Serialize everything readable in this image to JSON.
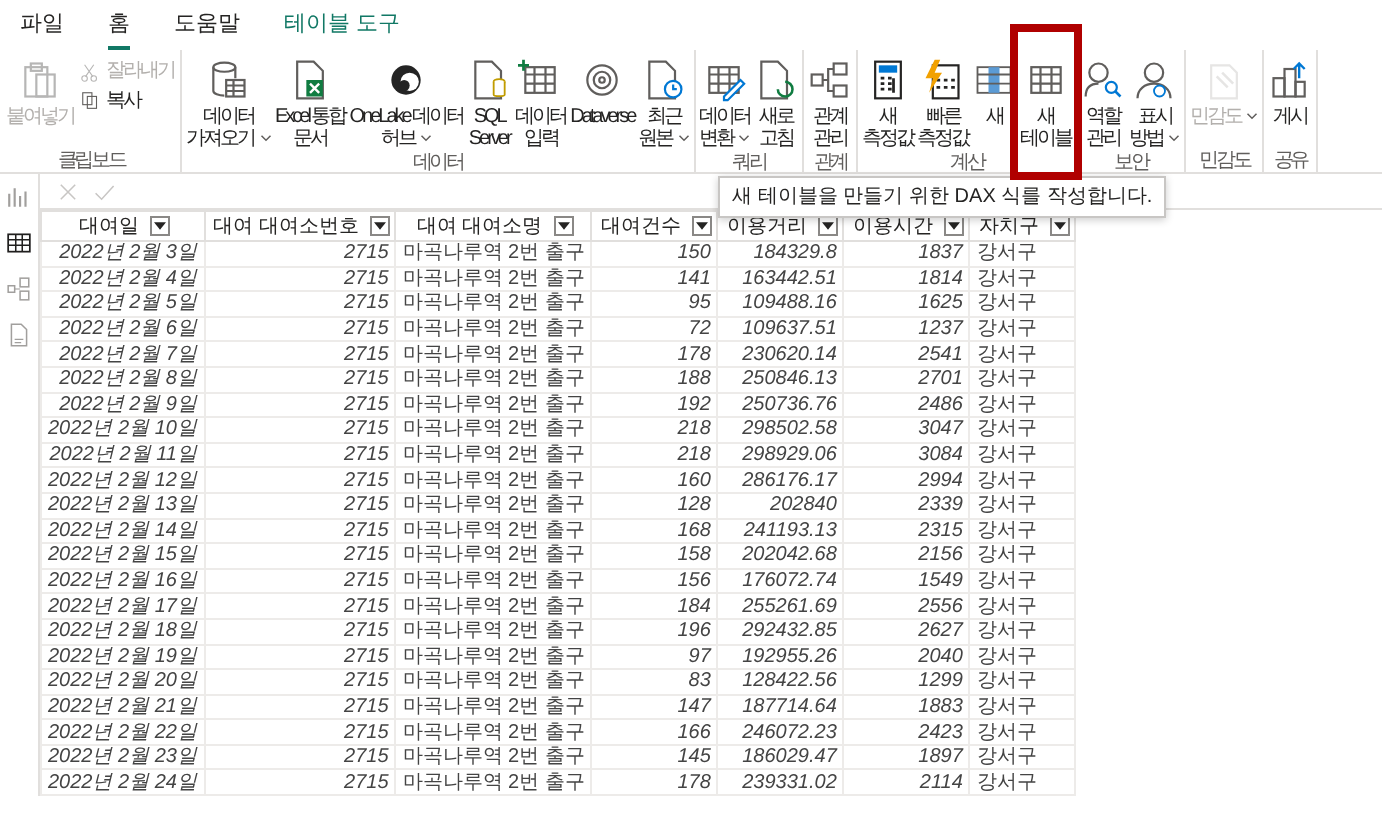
{
  "tabs": [
    {
      "label": "파일",
      "selected": false,
      "kind": "normal"
    },
    {
      "label": "홈",
      "selected": true,
      "kind": "normal"
    },
    {
      "label": "도움말",
      "selected": false,
      "kind": "normal"
    },
    {
      "label": "테이블 도구",
      "selected": false,
      "kind": "contextual"
    }
  ],
  "ribbon": {
    "groups": [
      {
        "label": "클립보드",
        "buttons": [
          {
            "kind": "large",
            "lines": [
              "붙여넣기"
            ],
            "disabled": true,
            "dropdown": false
          },
          {
            "kind": "small",
            "lines": [
              "잘라내기"
            ],
            "disabled": true,
            "dropdown": false
          },
          {
            "kind": "small",
            "lines": [
              "복사"
            ],
            "disabled": false,
            "dropdown": false
          }
        ]
      },
      {
        "label": "데이터",
        "buttons": [
          {
            "kind": "large",
            "lines": [
              "데이터",
              "가져오기"
            ],
            "disabled": false,
            "dropdown": true
          },
          {
            "kind": "large",
            "lines": [
              "Excel 통합",
              "문서"
            ],
            "disabled": false,
            "dropdown": false
          },
          {
            "kind": "large",
            "lines": [
              "OneLake 데이터",
              "허브"
            ],
            "disabled": false,
            "dropdown": true
          },
          {
            "kind": "large",
            "lines": [
              "SQL",
              "Server"
            ],
            "disabled": false,
            "dropdown": false
          },
          {
            "kind": "large",
            "lines": [
              "데이터",
              "입력"
            ],
            "disabled": false,
            "dropdown": false
          },
          {
            "kind": "large",
            "lines": [
              "Dataverse"
            ],
            "disabled": false,
            "dropdown": false
          },
          {
            "kind": "large",
            "lines": [
              "최근",
              "원본"
            ],
            "disabled": false,
            "dropdown": true
          }
        ]
      },
      {
        "label": "쿼리",
        "buttons": [
          {
            "kind": "large",
            "lines": [
              "데이터",
              "변환"
            ],
            "disabled": false,
            "dropdown": true
          },
          {
            "kind": "large",
            "lines": [
              "새로",
              "고침"
            ],
            "disabled": false,
            "dropdown": false
          }
        ]
      },
      {
        "label": "관계",
        "buttons": [
          {
            "kind": "large",
            "lines": [
              "관계",
              "관리"
            ],
            "disabled": false,
            "dropdown": false
          }
        ]
      },
      {
        "label": "계산",
        "buttons": [
          {
            "kind": "large",
            "lines": [
              "새",
              "측정값"
            ],
            "disabled": false,
            "dropdown": false
          },
          {
            "kind": "large",
            "lines": [
              "빠른",
              "측정값"
            ],
            "disabled": false,
            "dropdown": false
          },
          {
            "kind": "large",
            "lines": [
              "새"
            ],
            "disabled": false,
            "dropdown": false
          },
          {
            "kind": "large",
            "lines": [
              "새",
              "테이블"
            ],
            "disabled": false,
            "dropdown": false,
            "highlighted": true,
            "tooltip": "새 테이블을 만들기 위한 DAX 식를 작성합니다."
          }
        ]
      },
      {
        "label": "보안",
        "buttons": [
          {
            "kind": "large",
            "lines": [
              "역할",
              "관리"
            ],
            "disabled": false,
            "dropdown": false
          },
          {
            "kind": "large",
            "lines": [
              "표시",
              "방법"
            ],
            "disabled": false,
            "dropdown": true
          }
        ]
      },
      {
        "label": "민감도",
        "buttons": [
          {
            "kind": "large",
            "lines": [
              "민감도"
            ],
            "disabled": true,
            "dropdown": true
          }
        ]
      },
      {
        "label": "공유",
        "buttons": [
          {
            "kind": "large",
            "lines": [
              "게시"
            ],
            "disabled": false,
            "dropdown": false
          }
        ]
      }
    ]
  },
  "sidebar": {
    "views": [
      {
        "selected": false
      },
      {
        "selected": true
      },
      {
        "selected": false
      },
      {
        "selected": false
      }
    ]
  },
  "formula_bar": {
    "disabled": true
  },
  "table": {
    "columns": [
      "대여일",
      "대여 대여소번호",
      "대여 대여소명",
      "대여건수",
      "이용거리",
      "이용시간",
      "자치구"
    ],
    "rows": [
      [
        "2022년 2월 3일",
        "2715",
        "마곡나루역 2번 출구",
        "150",
        "184329.8",
        "1837",
        "강서구"
      ],
      [
        "2022년 2월 4일",
        "2715",
        "마곡나루역 2번 출구",
        "141",
        "163442.51",
        "1814",
        "강서구"
      ],
      [
        "2022년 2월 5일",
        "2715",
        "마곡나루역 2번 출구",
        "95",
        "109488.16",
        "1625",
        "강서구"
      ],
      [
        "2022년 2월 6일",
        "2715",
        "마곡나루역 2번 출구",
        "72",
        "109637.51",
        "1237",
        "강서구"
      ],
      [
        "2022년 2월 7일",
        "2715",
        "마곡나루역 2번 출구",
        "178",
        "230620.14",
        "2541",
        "강서구"
      ],
      [
        "2022년 2월 8일",
        "2715",
        "마곡나루역 2번 출구",
        "188",
        "250846.13",
        "2701",
        "강서구"
      ],
      [
        "2022년 2월 9일",
        "2715",
        "마곡나루역 2번 출구",
        "192",
        "250736.76",
        "2486",
        "강서구"
      ],
      [
        "2022년 2월 10일",
        "2715",
        "마곡나루역 2번 출구",
        "218",
        "298502.58",
        "3047",
        "강서구"
      ],
      [
        "2022년 2월 11일",
        "2715",
        "마곡나루역 2번 출구",
        "218",
        "298929.06",
        "3084",
        "강서구"
      ],
      [
        "2022년 2월 12일",
        "2715",
        "마곡나루역 2번 출구",
        "160",
        "286176.17",
        "2994",
        "강서구"
      ],
      [
        "2022년 2월 13일",
        "2715",
        "마곡나루역 2번 출구",
        "128",
        "202840",
        "2339",
        "강서구"
      ],
      [
        "2022년 2월 14일",
        "2715",
        "마곡나루역 2번 출구",
        "168",
        "241193.13",
        "2315",
        "강서구"
      ],
      [
        "2022년 2월 15일",
        "2715",
        "마곡나루역 2번 출구",
        "158",
        "202042.68",
        "2156",
        "강서구"
      ],
      [
        "2022년 2월 16일",
        "2715",
        "마곡나루역 2번 출구",
        "156",
        "176072.74",
        "1549",
        "강서구"
      ],
      [
        "2022년 2월 17일",
        "2715",
        "마곡나루역 2번 출구",
        "184",
        "255261.69",
        "2556",
        "강서구"
      ],
      [
        "2022년 2월 18일",
        "2715",
        "마곡나루역 2번 출구",
        "196",
        "292432.85",
        "2627",
        "강서구"
      ],
      [
        "2022년 2월 19일",
        "2715",
        "마곡나루역 2번 출구",
        "97",
        "192955.26",
        "2040",
        "강서구"
      ],
      [
        "2022년 2월 20일",
        "2715",
        "마곡나루역 2번 출구",
        "83",
        "128422.56",
        "1299",
        "강서구"
      ],
      [
        "2022년 2월 21일",
        "2715",
        "마곡나루역 2번 출구",
        "147",
        "187714.64",
        "1883",
        "강서구"
      ],
      [
        "2022년 2월 22일",
        "2715",
        "마곡나루역 2번 출구",
        "166",
        "246072.23",
        "2423",
        "강서구"
      ],
      [
        "2022년 2월 23일",
        "2715",
        "마곡나루역 2번 출구",
        "145",
        "186029.47",
        "1897",
        "강서구"
      ],
      [
        "2022년 2월 24일",
        "2715",
        "마곡나루역 2번 출구",
        "178",
        "239331.02",
        "2114",
        "강서구"
      ]
    ]
  }
}
